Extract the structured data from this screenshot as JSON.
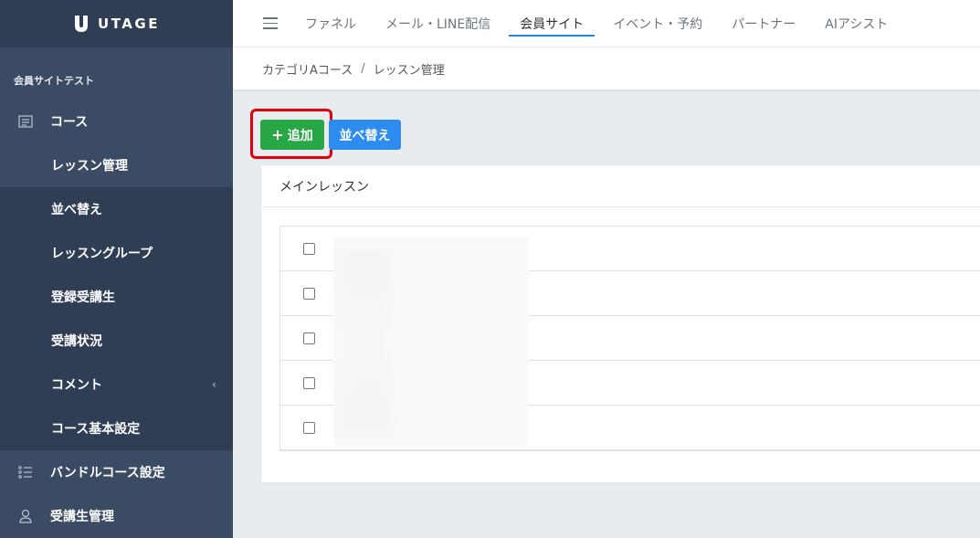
{
  "app": {
    "logo_text": "UTAGE",
    "site_title": "会員サイトテスト"
  },
  "sidebar": {
    "items": [
      {
        "label": "コース",
        "icon": "document-list-icon",
        "level": "top"
      },
      {
        "label": "レッスン管理",
        "level": "sub",
        "active": true
      },
      {
        "label": "並べ替え",
        "level": "sub"
      },
      {
        "label": "レッスングループ",
        "level": "sub"
      },
      {
        "label": "登録受講生",
        "level": "sub"
      },
      {
        "label": "受講状況",
        "level": "sub"
      },
      {
        "label": "コメント",
        "level": "sub",
        "chevron": "‹"
      },
      {
        "label": "コース基本設定",
        "level": "sub"
      },
      {
        "label": "バンドルコース設定",
        "icon": "list-icon",
        "level": "top"
      },
      {
        "label": "受講生管理",
        "icon": "user-icon",
        "level": "top"
      }
    ]
  },
  "topnav": {
    "tabs": [
      {
        "label": "ファネル"
      },
      {
        "label": "メール・LINE配信"
      },
      {
        "label": "会員サイト",
        "active": true
      },
      {
        "label": "イベント・予約"
      },
      {
        "label": "パートナー"
      },
      {
        "label": "AIアシスト"
      }
    ]
  },
  "breadcrumb": {
    "parent": "カテゴリAコース",
    "separator": "/",
    "current": "レッスン管理"
  },
  "toolbar": {
    "add_label": "追加",
    "add_icon": "+",
    "sort_label": "並べ替え"
  },
  "card": {
    "title": "メインレッスン",
    "row_count": 5
  },
  "colors": {
    "sidebar": "#3a4b63",
    "add_button": "#28a745",
    "sort_button": "#2d8cf0",
    "highlight": "#e3000f",
    "active_tab": "#1e88e5"
  }
}
